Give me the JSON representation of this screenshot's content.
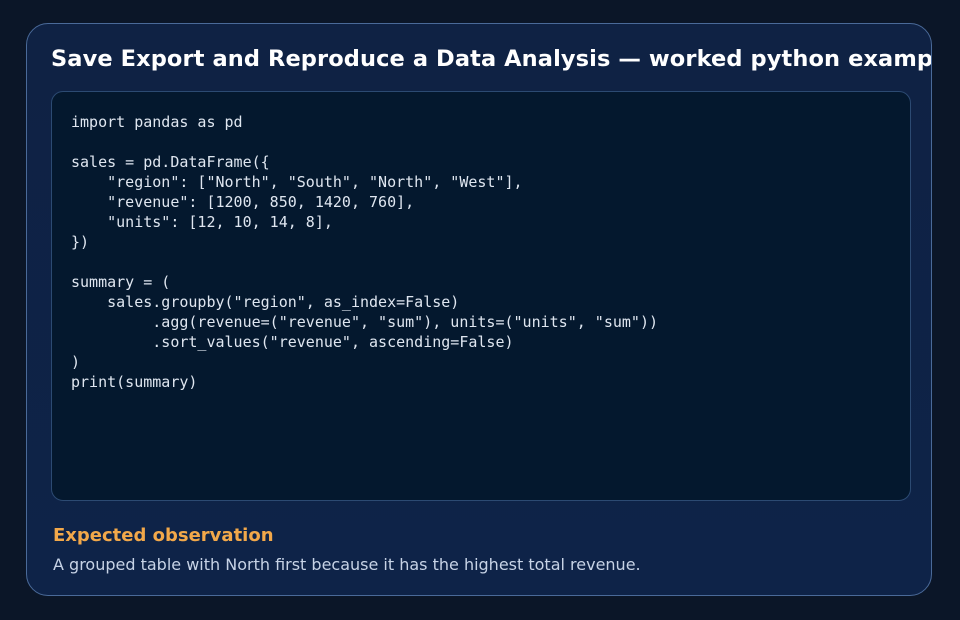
{
  "title": "Save Export and Reproduce a Data Analysis — worked python example",
  "code": {
    "language": "python",
    "source": "import pandas as pd\n\nsales = pd.DataFrame({\n    \"region\": [\"North\", \"South\", \"North\", \"West\"],\n    \"revenue\": [1200, 850, 1420, 760],\n    \"units\": [12, 10, 14, 8],\n})\n\nsummary = (\n    sales.groupby(\"region\", as_index=False)\n         .agg(revenue=(\"revenue\", \"sum\"), units=(\"units\", \"sum\"))\n         .sort_values(\"revenue\", ascending=False)\n)\nprint(summary)"
  },
  "observation": {
    "heading": "Expected observation",
    "text": "A grouped table with North first because it has the highest total revenue."
  },
  "colors": {
    "page_background": "#0b1628",
    "card_background": "#0f2244",
    "code_background": "#04182e",
    "heading_accent": "#f2a84a"
  }
}
